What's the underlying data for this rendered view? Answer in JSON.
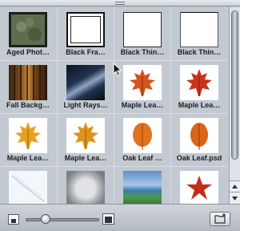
{
  "browser": {
    "items": [
      {
        "label": "Aged Phot…",
        "icon": "aged-photo-thumbnail",
        "selected": false
      },
      {
        "label": "Black Fra…",
        "icon": "black-frame-thumbnail",
        "selected": false
      },
      {
        "label": "Black Thin…",
        "icon": "black-thin-frame-thumbnail",
        "selected": false
      },
      {
        "label": "Black Thin…",
        "icon": "black-thin-frame-thumbnail",
        "selected": false
      },
      {
        "label": "Fall Backg…",
        "icon": "fall-background-thumbnail",
        "selected": false
      },
      {
        "label": "Light Rays…",
        "icon": "light-rays-thumbnail",
        "selected": false
      },
      {
        "label": "Maple Lea…",
        "icon": "maple-leaf-thumbnail",
        "selected": false
      },
      {
        "label": "Maple Lea…",
        "icon": "maple-leaf-thumbnail",
        "selected": false
      },
      {
        "label": "Maple Lea…",
        "icon": "maple-leaf-thumbnail",
        "selected": false
      },
      {
        "label": "Maple Lea…",
        "icon": "maple-leaf-thumbnail",
        "selected": false
      },
      {
        "label": "Oak Leaf …",
        "icon": "oak-leaf-thumbnail",
        "selected": false
      },
      {
        "label": "Oak Leaf.psd",
        "icon": "oak-leaf-thumbnail",
        "selected": false
      },
      {
        "label": "",
        "icon": "white-texture-thumbnail",
        "selected": false
      },
      {
        "label": "",
        "icon": "gray-burst-thumbnail",
        "selected": false
      },
      {
        "label": "",
        "icon": "landscape-thumbnail",
        "selected": false
      },
      {
        "label": "",
        "icon": "star-thumbnail",
        "selected": false
      }
    ]
  },
  "toolbar": {
    "icon_small": "small-thumbnail-icon",
    "icon_large": "large-thumbnail-icon",
    "icon_folder": "new-folder-icon",
    "zoom_fraction": 0.24
  },
  "colors": {
    "panel": "#b9c0c9",
    "grid": "#c3c9d1",
    "label": "#1b1e22"
  }
}
